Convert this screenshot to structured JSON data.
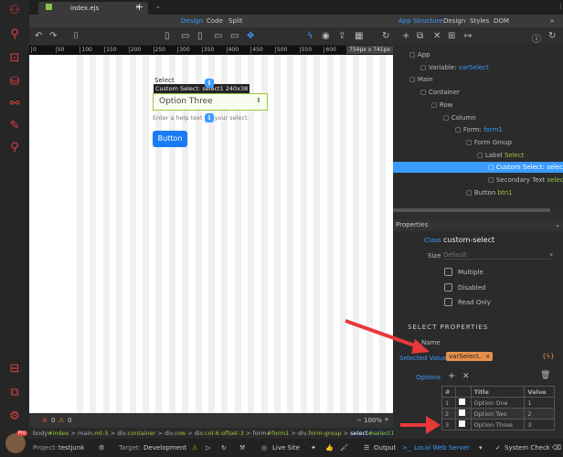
{
  "tab": {
    "title": "index.ejs"
  },
  "modes": [
    "Design",
    "Code",
    "Split"
  ],
  "panel_tabs": [
    "App Structure",
    "Design",
    "Styles",
    "DOM"
  ],
  "ruler_ticks": [
    "0",
    "50",
    "100",
    "150",
    "200",
    "250",
    "300",
    "350",
    "400",
    "450",
    "500",
    "550",
    "600",
    "650",
    "700"
  ],
  "size_badge": "754px x 741px",
  "canvas": {
    "label": "Select",
    "tooltip": "Custom Select: select1 240x38",
    "select_value": "Option Three",
    "help": "Enter a help text for your select.",
    "button": "Button"
  },
  "status": {
    "errors": "0",
    "warnings": "0",
    "zoom": "100%"
  },
  "breadcrumb": [
    {
      "t": "body",
      "c": "#index"
    },
    {
      "t": "main",
      "c": ".mt-5"
    },
    {
      "t": "div",
      "c": ".container"
    },
    {
      "t": "div",
      "c": ".row"
    },
    {
      "t": "div",
      "c": ".col-6.offset-3"
    },
    {
      "t": "form",
      "c": "#form1"
    },
    {
      "t": "div",
      "c": ".form-group"
    },
    {
      "t": "select",
      "c": "#select1.custom-"
    }
  ],
  "tree": [
    {
      "label": "App",
      "val": "",
      "cls": ""
    },
    {
      "label": "Variable: ",
      "val": "varSelect",
      "cls": "b"
    },
    {
      "label": "Main",
      "val": "",
      "cls": ""
    },
    {
      "label": "Container",
      "val": "",
      "cls": ""
    },
    {
      "label": "Row",
      "val": "",
      "cls": ""
    },
    {
      "label": "Column",
      "val": "",
      "cls": ""
    },
    {
      "label": "Form: ",
      "val": "form1",
      "cls": "b"
    },
    {
      "label": "Form Group",
      "val": "",
      "cls": ""
    },
    {
      "label": "Label ",
      "val": "Select",
      "cls": "gr"
    },
    {
      "label": "Custom Select: select1",
      "val": "",
      "cls": ""
    },
    {
      "label": "Secondary Text ",
      "val": "select1",
      "cls": "gr"
    },
    {
      "label": "Button ",
      "val": "btn1",
      "cls": "gr"
    }
  ],
  "properties": {
    "header": "Properties",
    "class_label": "Class",
    "class_value": "custom-select",
    "size_label": "Size",
    "size_value": "Default",
    "checks": [
      "Multiple",
      "Disabled",
      "Read Only"
    ],
    "section": "SELECT PROPERTIES",
    "name_label": "Name",
    "selected_label": "Selected Value",
    "selected_value": "varSelect..",
    "options_label": "Options",
    "table": {
      "headers": [
        "#",
        "",
        "Title",
        "Value"
      ],
      "rows": [
        [
          "1",
          "Option One",
          "1"
        ],
        [
          "2",
          "Option Two",
          "2"
        ],
        [
          "3",
          "Option Three",
          "3"
        ]
      ]
    }
  },
  "footer": {
    "project_label": "Project:",
    "project": "testjunk",
    "target_label": "Target:",
    "target": "Development",
    "live": "Live Site",
    "output": "Output",
    "server": "Local Web Server",
    "check": "System Check",
    "pro": "Pro"
  },
  "colors": {
    "accent": "#3a9bff",
    "selected_row": "#3a9bff",
    "arrow": "#e8393a",
    "binding": "#e8914a"
  }
}
